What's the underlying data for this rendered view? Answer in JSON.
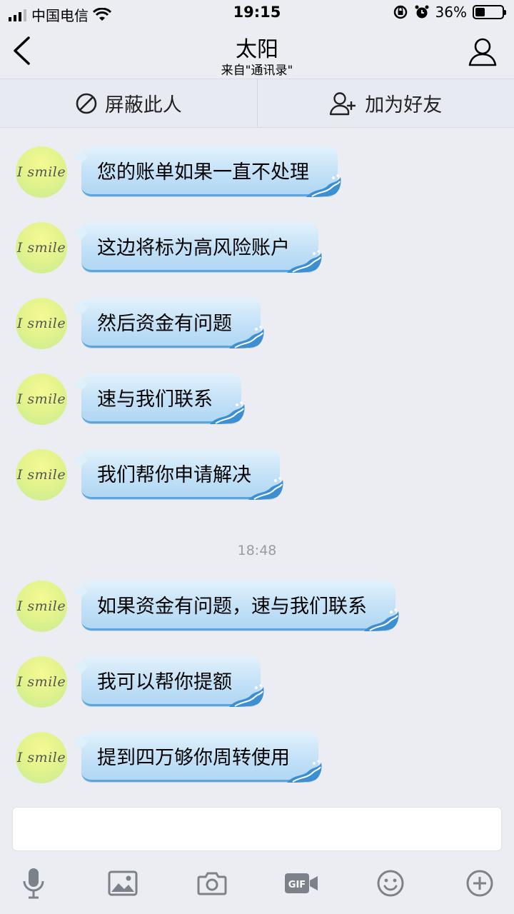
{
  "status_bar": {
    "carrier": "中国电信",
    "time": "19:15",
    "battery_percent": "36%",
    "battery_level": 0.36
  },
  "nav": {
    "title": "太阳",
    "subtitle": "来自\"通讯录\""
  },
  "actions": {
    "block_label": "屏蔽此人",
    "add_friend_label": "加为好友"
  },
  "avatar_text": "I smile",
  "messages_group1": [
    {
      "text": "您的账单如果一直不处理"
    },
    {
      "text": "这边将标为高风险账户"
    },
    {
      "text": "然后资金有问题"
    },
    {
      "text": "速与我们联系"
    },
    {
      "text": "我们帮你申请解决"
    }
  ],
  "timestamp": "18:48",
  "messages_group2": [
    {
      "text": "如果资金有问题，速与我们联系"
    },
    {
      "text": "我可以帮你提额"
    },
    {
      "text": "提到四万够你周转使用"
    }
  ],
  "input": {
    "value": ""
  },
  "toolbar": {
    "icons": [
      "microphone-icon",
      "image-icon",
      "camera-icon",
      "gif-icon",
      "emoji-icon",
      "plus-icon"
    ],
    "gif_label": "GIF"
  },
  "colors": {
    "bubble_top": "#e3f2fc",
    "bubble_bottom": "#b1d7f3",
    "bubble_border": "#5aa6dd",
    "background": "#ecedf2",
    "action_bar": "#e7ebf1"
  }
}
